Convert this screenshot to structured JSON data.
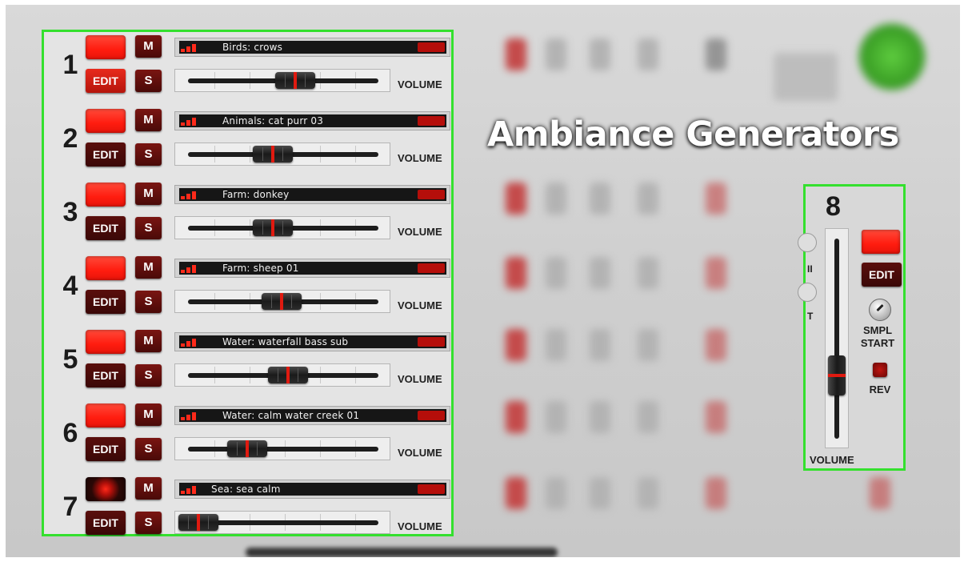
{
  "title": "Ambiance Generators",
  "tracks": [
    {
      "number": "1",
      "name": "Birds: crows",
      "edit": "EDIT",
      "mute": "M",
      "solo": "S",
      "volume_label": "VOLUME",
      "led_on": true,
      "edit_active": true,
      "volume": 0.57
    },
    {
      "number": "2",
      "name": "Animals: cat purr 03",
      "edit": "EDIT",
      "mute": "M",
      "solo": "S",
      "volume_label": "VOLUME",
      "led_on": true,
      "edit_active": false,
      "volume": 0.44
    },
    {
      "number": "3",
      "name": "Farm: donkey",
      "edit": "EDIT",
      "mute": "M",
      "solo": "S",
      "volume_label": "VOLUME",
      "led_on": true,
      "edit_active": false,
      "volume": 0.44
    },
    {
      "number": "4",
      "name": "Farm: sheep 01",
      "edit": "EDIT",
      "mute": "M",
      "solo": "S",
      "volume_label": "VOLUME",
      "led_on": true,
      "edit_active": false,
      "volume": 0.49
    },
    {
      "number": "5",
      "name": "Water: waterfall bass sub",
      "edit": "EDIT",
      "mute": "M",
      "solo": "S",
      "volume_label": "VOLUME",
      "led_on": true,
      "edit_active": false,
      "volume": 0.53
    },
    {
      "number": "6",
      "name": "Water: calm water creek 01",
      "edit": "EDIT",
      "mute": "M",
      "solo": "S",
      "volume_label": "VOLUME",
      "led_on": true,
      "edit_active": false,
      "volume": 0.29
    },
    {
      "number": "7",
      "name": "Sea: sea calm",
      "edit": "EDIT",
      "mute": "M",
      "solo": "S",
      "volume_label": "VOLUME",
      "led_on": false,
      "edit_active": false,
      "volume": 0.0
    }
  ],
  "track8": {
    "number": "8",
    "edit": "EDIT",
    "smpl": "SMPL",
    "start": "START",
    "rev": "REV",
    "volume_label": "VOLUME",
    "partial_labels": [
      "II",
      "T"
    ],
    "volume": 0.28
  },
  "colors": {
    "highlight": "#34e02e",
    "led": "#ff1c0f",
    "button": "#4a0a08"
  }
}
